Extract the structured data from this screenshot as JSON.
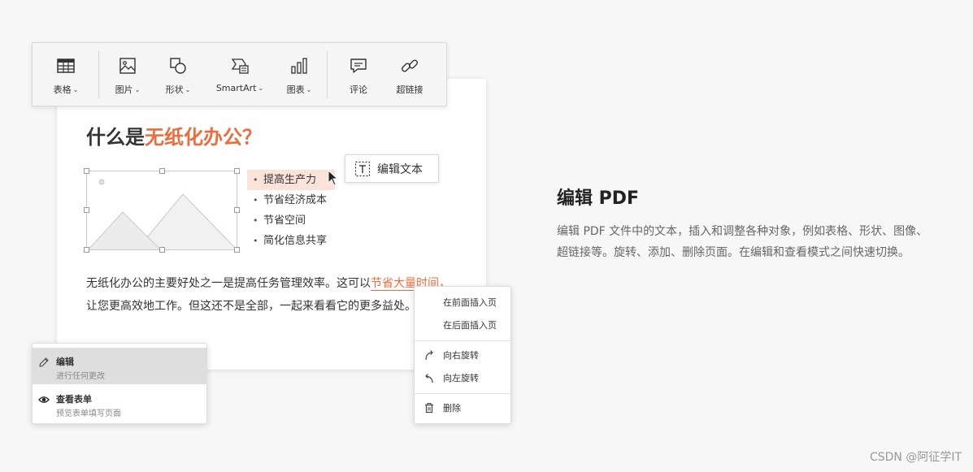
{
  "colors": {
    "accent": "#ee6b3b",
    "highlight_bg": "#fbe3d9",
    "page_bg": "#f7f7f7"
  },
  "toolbar": {
    "items": [
      {
        "label": "表格",
        "icon": "table-icon",
        "has_menu": true
      },
      {
        "label": "图片",
        "icon": "image-icon",
        "has_menu": true
      },
      {
        "label": "形状",
        "icon": "shape-icon",
        "has_menu": true
      },
      {
        "label": "SmartArt",
        "icon": "smartart-icon",
        "has_menu": true
      },
      {
        "label": "图表",
        "icon": "bar-chart-icon",
        "has_menu": true
      },
      {
        "label": "评论",
        "icon": "comment-icon",
        "has_menu": false
      },
      {
        "label": "超链接",
        "icon": "link-icon",
        "has_menu": false
      }
    ],
    "caret": "⌄"
  },
  "document": {
    "title_prefix": "什么是",
    "title_accent": "无纸化办公？",
    "bullets": [
      "提高生产力",
      "节省经济成本",
      "节省空间",
      "简化信息共享"
    ],
    "para_before": "无纸化办公的主要好处之一是提高任务管理效率。这可以",
    "para_link": "节省大量时间，",
    "para_after": "让您更高效地工作。但这还不是全部，一起来看看它的更多益处。"
  },
  "edit_text_chip": {
    "label": "编辑文本",
    "icon": "text-box-icon"
  },
  "mode_panel": {
    "items": [
      {
        "title": "编辑",
        "subtitle": "进行任何更改",
        "icon": "pencil-icon",
        "active": true
      },
      {
        "title": "查看表单",
        "subtitle": "预览表单填写页面",
        "icon": "eye-icon",
        "active": false
      }
    ]
  },
  "context_menu": {
    "items": [
      {
        "label": "在前面插入页",
        "icon": ""
      },
      {
        "label": "在后面插入页",
        "icon": ""
      },
      {
        "label": "向右旋转",
        "icon": "rotate-right-icon"
      },
      {
        "label": "向左旋转",
        "icon": "rotate-left-icon"
      },
      {
        "label": "删除",
        "icon": "trash-icon"
      }
    ]
  },
  "feature": {
    "title": "编辑 PDF",
    "description": "编辑 PDF 文件中的文本，插入和调整各种对象，例如表格、形状、图像、超链接等。旋转、添加、删除页面。在编辑和查看模式之间快速切换。"
  },
  "watermark": "CSDN @阿征学IT"
}
